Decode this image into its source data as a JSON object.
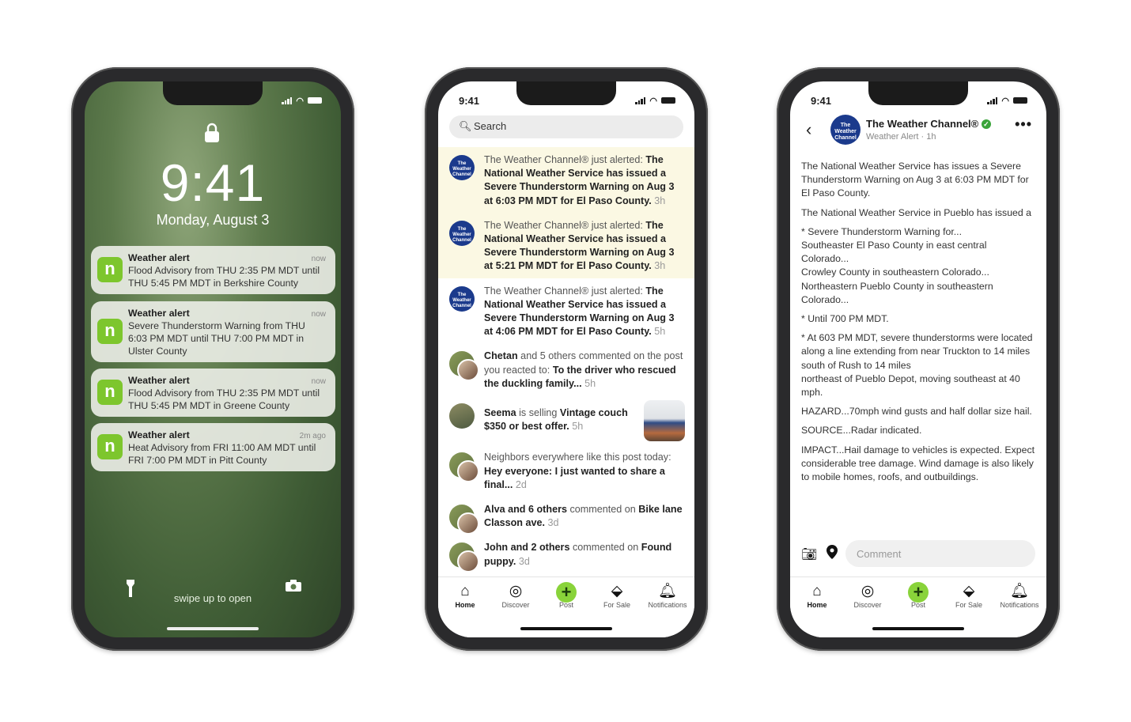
{
  "lock_screen": {
    "time": "9:41",
    "date": "Monday, August 3",
    "notifications": [
      {
        "app_icon": "n",
        "title": "Weather alert",
        "when": "now",
        "body": "Flood Advisory from THU 2:35 PM MDT until THU 5:45 PM MDT in Berkshire County"
      },
      {
        "app_icon": "n",
        "title": "Weather alert",
        "when": "now",
        "body": "Severe Thunderstorm Warning from THU 6:03 PM MDT until THU 7:00 PM MDT in Ulster County"
      },
      {
        "app_icon": "n",
        "title": "Weather alert",
        "when": "now",
        "body": "Flood Advisory from THU 2:35 PM MDT until THU 5:45 PM MDT in Greene County"
      },
      {
        "app_icon": "n",
        "title": "Weather alert",
        "when": "2m ago",
        "body": "Heat Advisory from FRI 11:00 AM MDT until FRI 7:00 PM MDT in Pitt County"
      }
    ],
    "swipe_hint": "swipe up to open"
  },
  "notifications_screen": {
    "status_time": "9:41",
    "search_placeholder": "Search",
    "items": [
      {
        "avatar": "twc",
        "highlight": true,
        "segments": [
          {
            "t": "The Weather Channel® just alerted: "
          },
          {
            "t": "The National Weather Service has issued a Severe Thunderstorm Warning on Aug 3 at 6:03 PM MDT for El Paso County.",
            "b": true
          },
          {
            "t": " 3h",
            "tm": true
          }
        ]
      },
      {
        "avatar": "twc",
        "highlight": true,
        "segments": [
          {
            "t": "The Weather Channel® just alerted: "
          },
          {
            "t": "The National Weather Service has issued a Severe Thunderstorm Warning on Aug 3 at 5:21 PM MDT for El Paso County.",
            "b": true
          },
          {
            "t": " 3h",
            "tm": true
          }
        ]
      },
      {
        "avatar": "twc",
        "highlight": false,
        "segments": [
          {
            "t": "The Weather Channel® just alerted: "
          },
          {
            "t": "The National Weather Service has issued a Severe Thunderstorm Warning on Aug 3 at 4:06 PM MDT for El Paso County.",
            "b": true
          },
          {
            "t": " 5h",
            "tm": true
          }
        ]
      },
      {
        "avatar": "group",
        "highlight": false,
        "segments": [
          {
            "t": "Chetan",
            "b": true
          },
          {
            "t": " and 5 others commented on the post you reacted to: "
          },
          {
            "t": "To the driver who rescued the duckling family...",
            "b": true
          },
          {
            "t": " 5h",
            "tm": true
          }
        ]
      },
      {
        "avatar": "single",
        "highlight": false,
        "thumbnail": true,
        "segments": [
          {
            "t": "Seema",
            "b": true
          },
          {
            "t": " is selling "
          },
          {
            "t": "Vintage couch $350 or best offer.",
            "b": true
          },
          {
            "t": " 5h",
            "tm": true
          }
        ]
      },
      {
        "avatar": "group",
        "highlight": false,
        "segments": [
          {
            "t": "Neighbors everywhere like this post today: "
          },
          {
            "t": "Hey everyone: I just wanted to share a final...",
            "b": true
          },
          {
            "t": " 2d",
            "tm": true
          }
        ]
      },
      {
        "avatar": "group",
        "highlight": false,
        "segments": [
          {
            "t": "Alva and 6 others",
            "b": true
          },
          {
            "t": " commented on "
          },
          {
            "t": "Bike lane Classon ave.",
            "b": true
          },
          {
            "t": " 3d",
            "tm": true
          }
        ]
      },
      {
        "avatar": "group",
        "highlight": false,
        "segments": [
          {
            "t": "John and 2 others",
            "b": true
          },
          {
            "t": " commented on "
          },
          {
            "t": "Found puppy.",
            "b": true
          },
          {
            "t": " 3d",
            "tm": true
          }
        ]
      }
    ]
  },
  "detail_screen": {
    "status_time": "9:41",
    "author": "The Weather Channel®",
    "avatar_text": "The Weather Channel",
    "subtitle": "Weather Alert · 1h",
    "paragraphs": [
      "The National Weather Service has issues a Severe Thunderstorm Warning on Aug 3 at 6:03 PM MDT for El Paso County.",
      "The National Weather Service in Pueblo has issued a",
      "* Severe Thunderstorm Warning for...\nSoutheaster El Paso County in east central Colorado...\nCrowley County in southeastern Colorado...\nNortheastern Pueblo County in southeastern Colorado...",
      "* Until 700 PM MDT.",
      "* At 603 PM MDT, severe thunderstorms were located along a line extending from near Truckton to 14 miles south of Rush to 14 miles\nnortheast of Pueblo Depot, moving southeast at 40 mph.",
      "HAZARD...70mph wind gusts and half dollar size hail.",
      "SOURCE...Radar indicated.",
      "IMPACT...Hail damage to vehicles is expected. Expect considerable tree damage. Wind damage is also likely to mobile homes, roofs, and outbuildings."
    ],
    "comment_placeholder": "Comment"
  },
  "tabs": [
    {
      "label": "Home",
      "icon": "home-icon",
      "active": true
    },
    {
      "label": "Discover",
      "icon": "compass-icon"
    },
    {
      "label": "Post",
      "icon": "plus-icon"
    },
    {
      "label": "For Sale",
      "icon": "tag-icon"
    },
    {
      "label": "Notifications",
      "icon": "bell-icon"
    }
  ],
  "colors": {
    "brand_green": "#89d33a",
    "highlight": "#fbf8e3",
    "twc_blue": "#1b3a8c"
  }
}
